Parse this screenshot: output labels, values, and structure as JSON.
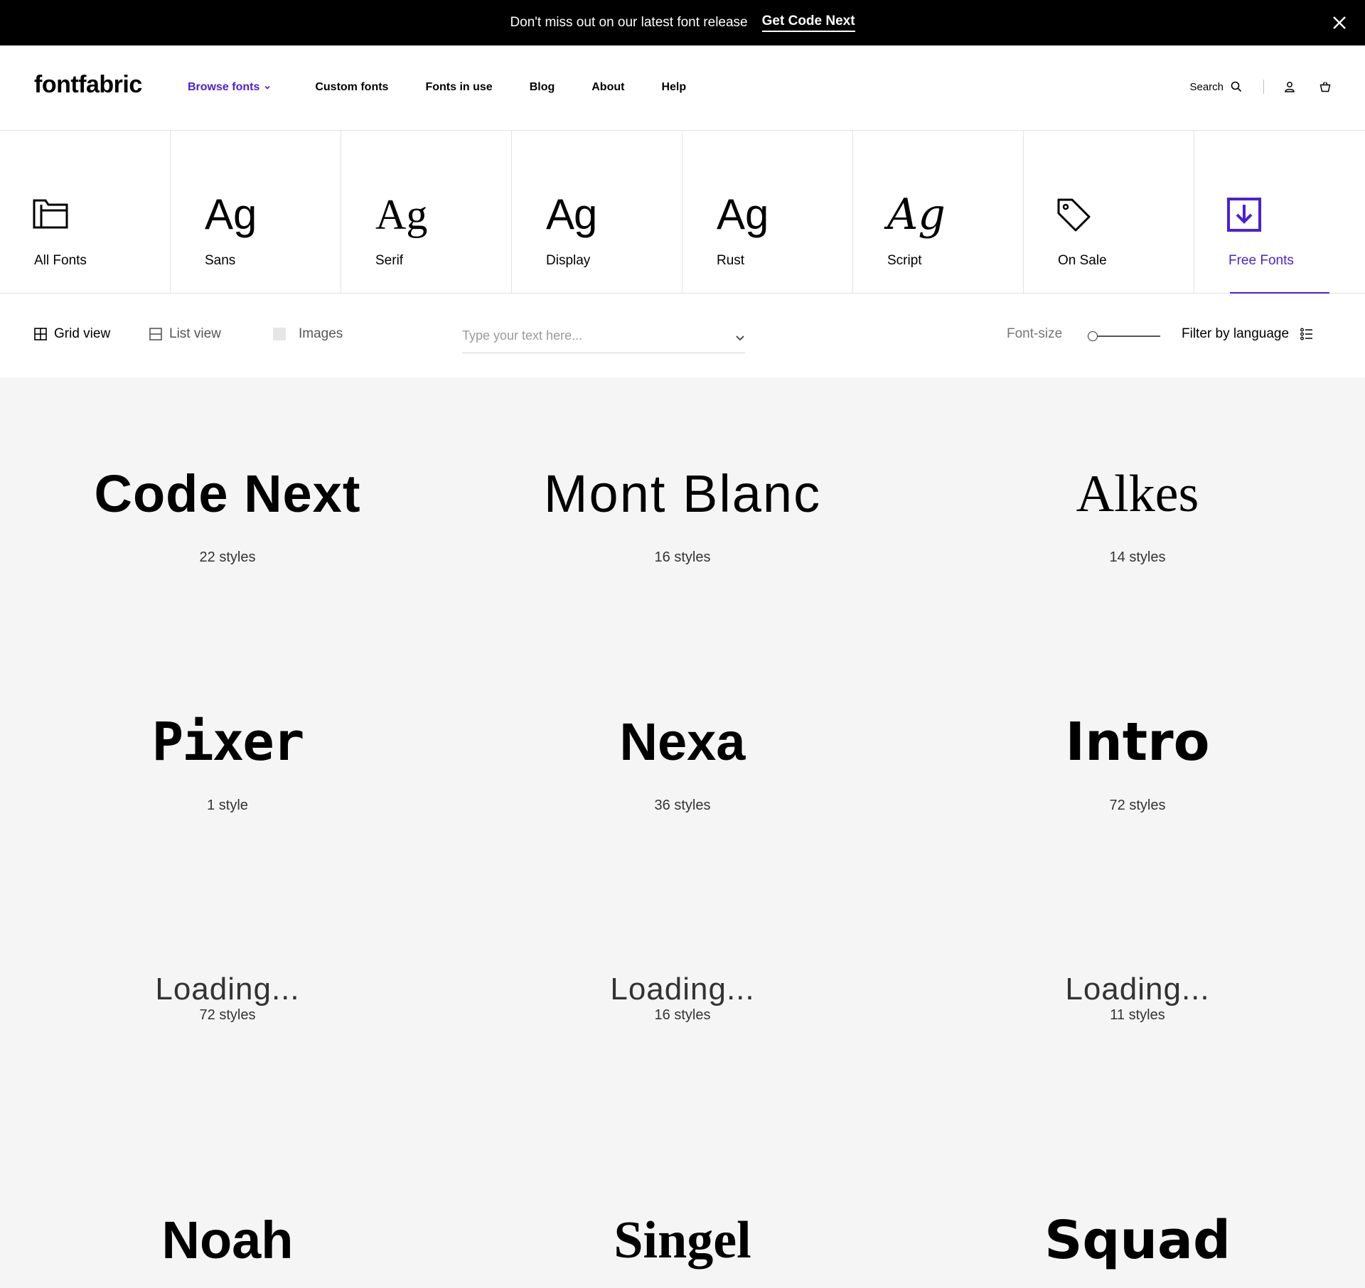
{
  "announcement": {
    "message": "Don't miss out on our latest font release",
    "cta": "Get Code Next"
  },
  "header": {
    "logo": "fontfabric",
    "nav": [
      {
        "label": "Browse fonts",
        "active": true
      },
      {
        "label": "Custom fonts"
      },
      {
        "label": "Fonts in use"
      },
      {
        "label": "Blog"
      },
      {
        "label": "About"
      },
      {
        "label": "Help"
      }
    ],
    "search_label": "Search",
    "accent_color": "#4b1fd9"
  },
  "categories": [
    {
      "label": "All Fonts",
      "icon": "folder-icon"
    },
    {
      "label": "Sans",
      "glyph": "Ag"
    },
    {
      "label": "Serif",
      "glyph": "Ag"
    },
    {
      "label": "Display",
      "glyph": "Ag"
    },
    {
      "label": "Rust",
      "glyph": "Ag"
    },
    {
      "label": "Script",
      "glyph": "Ag"
    },
    {
      "label": "On Sale",
      "icon": "tag-icon"
    },
    {
      "label": "Free Fonts",
      "icon": "download-icon",
      "active": true
    }
  ],
  "toolbar": {
    "grid_view": "Grid view",
    "list_view": "List view",
    "images": "Images",
    "text_placeholder": "Type your text here...",
    "font_size_label": "Font-size",
    "font_size_value": 0,
    "filter_language": "Filter by language"
  },
  "fonts": [
    {
      "name": "Code Next",
      "styles": "22 styles"
    },
    {
      "name": "Mont Blanc",
      "styles": "16 styles"
    },
    {
      "name": "Alkes",
      "styles": "14 styles"
    },
    {
      "name": "Pixer",
      "styles": "1 style"
    },
    {
      "name": "Nexa",
      "styles": "36 styles"
    },
    {
      "name": "Intro",
      "styles": "72 styles"
    },
    {
      "name": "Loading...",
      "styles": "72 styles"
    },
    {
      "name": "Loading...",
      "styles": "16 styles"
    },
    {
      "name": "Loading...",
      "styles": "11 styles"
    },
    {
      "name": "Noah",
      "styles": ""
    },
    {
      "name": "Singel",
      "styles": ""
    },
    {
      "name": "Squad",
      "styles": ""
    }
  ]
}
